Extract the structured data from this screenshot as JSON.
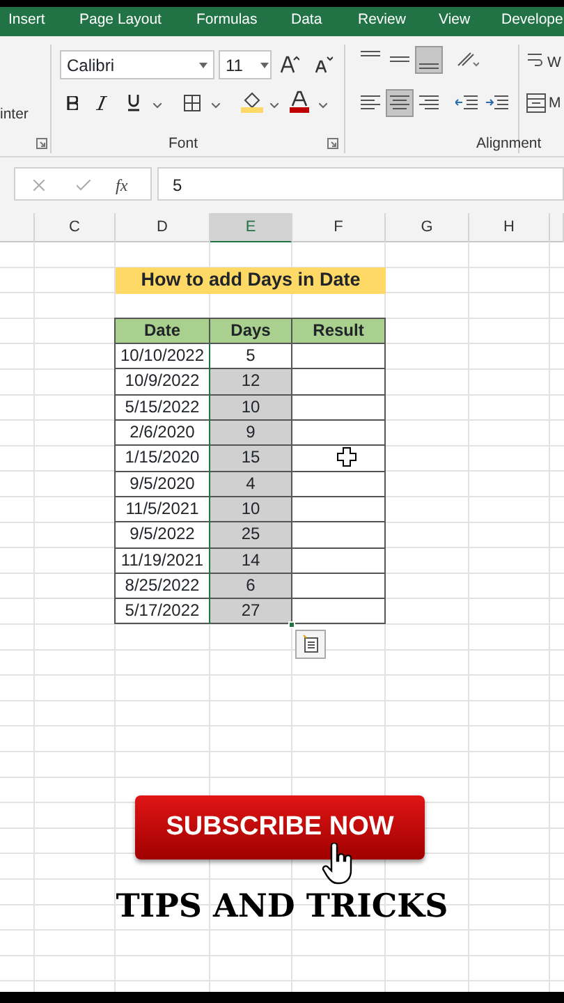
{
  "ribbon": {
    "tabs": [
      "Insert",
      "Page Layout",
      "Formulas",
      "Data",
      "Review",
      "View",
      "Develope"
    ],
    "clipboard_group": {
      "label_fragment": "inter"
    },
    "font_group": {
      "font_name": "Calibri",
      "font_size": "11",
      "label": "Font"
    },
    "alignment_group": {
      "label": "Alignment",
      "wrap_fragment": "W",
      "merge_fragment": "M"
    }
  },
  "formula_bar": {
    "function_label": "fx",
    "value": "5"
  },
  "column_headers": [
    {
      "label": "C",
      "selected": false
    },
    {
      "label": "D",
      "selected": false
    },
    {
      "label": "E",
      "selected": true
    },
    {
      "label": "F",
      "selected": false
    },
    {
      "label": "G",
      "selected": false
    },
    {
      "label": "H",
      "selected": false
    }
  ],
  "sheet": {
    "title": "How to add Days in Date",
    "columns": [
      "Date",
      "Days",
      "Result"
    ],
    "rows": [
      {
        "date": "10/10/2022",
        "days": "5",
        "selected": true,
        "active": true
      },
      {
        "date": "10/9/2022",
        "days": "12",
        "selected": true,
        "active": false
      },
      {
        "date": "5/15/2022",
        "days": "10",
        "selected": true,
        "active": false
      },
      {
        "date": "2/6/2020",
        "days": "9",
        "selected": true,
        "active": false
      },
      {
        "date": "1/15/2020",
        "days": "15",
        "selected": true,
        "active": false
      },
      {
        "date": "9/5/2020",
        "days": "4",
        "selected": true,
        "active": false
      },
      {
        "date": "11/5/2021",
        "days": "10",
        "selected": true,
        "active": false
      },
      {
        "date": "9/5/2022",
        "days": "25",
        "selected": true,
        "active": false
      },
      {
        "date": "11/19/2021",
        "days": "14",
        "selected": true,
        "active": false
      },
      {
        "date": "8/25/2022",
        "days": "6",
        "selected": true,
        "active": false
      },
      {
        "date": "5/17/2022",
        "days": "27",
        "selected": true,
        "active": false
      }
    ]
  },
  "overlay": {
    "button": "SUBSCRIBE NOW",
    "caption": "TIPS AND TRICKS"
  }
}
